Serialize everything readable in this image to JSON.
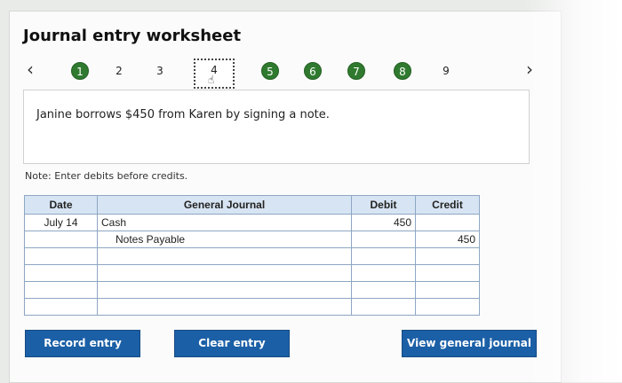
{
  "header": {
    "title": "Journal entry worksheet"
  },
  "steps": [
    {
      "label": "1",
      "state": "done"
    },
    {
      "label": "2",
      "state": "plain"
    },
    {
      "label": "3",
      "state": "plain"
    },
    {
      "label": "4",
      "state": "current"
    },
    {
      "label": "5",
      "state": "done"
    },
    {
      "label": "6",
      "state": "done"
    },
    {
      "label": "7",
      "state": "done"
    },
    {
      "label": "8",
      "state": "done"
    },
    {
      "label": "9",
      "state": "plain"
    }
  ],
  "prompt": "Janine borrows $450 from Karen by signing a note.",
  "note": "Note: Enter debits before credits.",
  "table": {
    "headers": {
      "date": "Date",
      "journal": "General Journal",
      "debit": "Debit",
      "credit": "Credit"
    },
    "rows": [
      {
        "date": "July 14",
        "account": "Cash",
        "indent": false,
        "debit": "450",
        "credit": ""
      },
      {
        "date": "",
        "account": "Notes Payable",
        "indent": true,
        "debit": "",
        "credit": "450"
      },
      {
        "date": "",
        "account": "",
        "indent": false,
        "debit": "",
        "credit": ""
      },
      {
        "date": "",
        "account": "",
        "indent": false,
        "debit": "",
        "credit": ""
      },
      {
        "date": "",
        "account": "",
        "indent": false,
        "debit": "",
        "credit": ""
      },
      {
        "date": "",
        "account": "",
        "indent": false,
        "debit": "",
        "credit": ""
      }
    ]
  },
  "buttons": {
    "record": "Record entry",
    "clear": "Clear entry",
    "view": "View general journal"
  },
  "colors": {
    "step_done": "#2f7a2f",
    "button": "#1b5fa6",
    "table_header": "#d7e4f3"
  }
}
